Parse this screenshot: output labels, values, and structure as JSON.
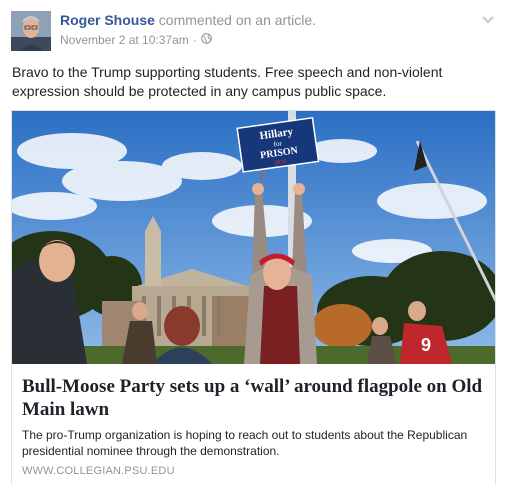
{
  "post": {
    "author": "Roger Shouse",
    "action": "commented on an article.",
    "timestamp": "November 2 at 10:37am",
    "privacy_icon": "globe-icon",
    "menu_icon": "chevron-down-icon",
    "text": "Bravo to the Trump supporting students. Free speech and non-violent expression should be protected in any campus public space."
  },
  "article": {
    "sign_text_line1": "Hillary",
    "sign_text_line2": "for",
    "sign_text_line3": "PRISON",
    "sign_text_line4": "2016",
    "jersey_number": "9",
    "headline": "Bull-Moose Party sets up a ‘wall’ around flagpole on Old Main lawn",
    "description": "The pro-Trump organization is hoping to reach out to students about the Republican presidential nominee through the demonstration.",
    "domain": "WWW.COLLEGIAN.PSU.EDU"
  },
  "colors": {
    "author_link": "#365899",
    "meta_gray": "#90949c",
    "text": "#1d2129",
    "border": "#dddfe2"
  }
}
